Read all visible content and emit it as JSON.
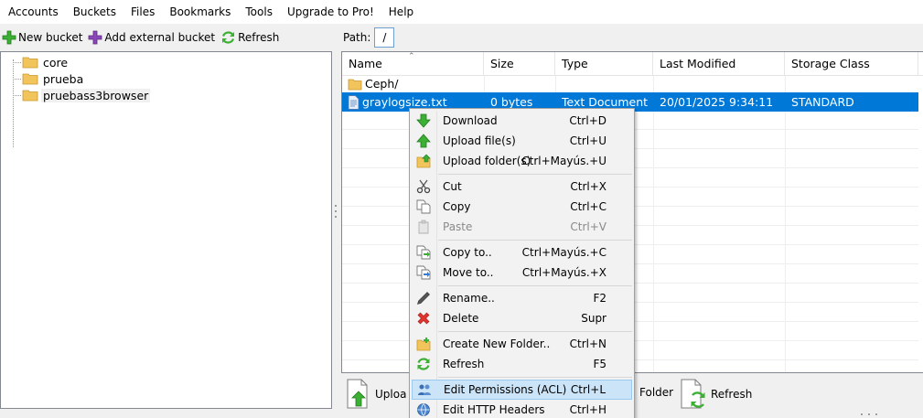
{
  "menubar": [
    "Accounts",
    "Buckets",
    "Files",
    "Bookmarks",
    "Tools",
    "Upgrade to Pro!",
    "Help"
  ],
  "left_toolbar": {
    "new_bucket": "New bucket",
    "add_external_bucket": "Add external bucket",
    "refresh": "Refresh"
  },
  "tree": {
    "items": [
      {
        "label": "core"
      },
      {
        "label": "prueba"
      },
      {
        "label": "pruebass3browser"
      }
    ]
  },
  "path": {
    "label": "Path:",
    "value": "/"
  },
  "file_list": {
    "columns": [
      "Name",
      "Size",
      "Type",
      "Last Modified",
      "Storage Class"
    ],
    "rows": [
      {
        "name": "Ceph/",
        "size": "",
        "type": "",
        "modified": "",
        "storage": ""
      },
      {
        "name": "graylogsize.txt",
        "size": "0 bytes",
        "type": "Text Document",
        "modified": "20/01/2025 9:34:11",
        "storage": "STANDARD"
      }
    ]
  },
  "bottom_toolbar": {
    "upload": "Uploa",
    "new_folder": "Folder",
    "refresh": "Refresh"
  },
  "context_menu": {
    "items": [
      {
        "label": "Download",
        "shortcut": "Ctrl+D",
        "icon": "download-arrow-icon"
      },
      {
        "label": "Upload file(s)",
        "shortcut": "Ctrl+U",
        "icon": "upload-arrow-icon"
      },
      {
        "label": "Upload folder(s)",
        "shortcut": "Ctrl+Mayús.+U",
        "icon": "upload-folder-icon"
      },
      {
        "label": "Cut",
        "shortcut": "Ctrl+X",
        "icon": "scissors-icon"
      },
      {
        "label": "Copy",
        "shortcut": "Ctrl+C",
        "icon": "copy-icon"
      },
      {
        "label": "Paste",
        "shortcut": "Ctrl+V",
        "icon": "paste-icon"
      },
      {
        "label": "Copy to..",
        "shortcut": "Ctrl+Mayús.+C",
        "icon": "copy-to-icon"
      },
      {
        "label": "Move to..",
        "shortcut": "Ctrl+Mayús.+X",
        "icon": "move-to-icon"
      },
      {
        "label": "Rename..",
        "shortcut": "F2",
        "icon": "pencil-icon"
      },
      {
        "label": "Delete",
        "shortcut": "Supr",
        "icon": "red-x-icon"
      },
      {
        "label": "Create New Folder..",
        "shortcut": "Ctrl+N",
        "icon": "new-folder-icon"
      },
      {
        "label": "Refresh",
        "shortcut": "F5",
        "icon": "refresh-icon"
      },
      {
        "label": "Edit Permissions (ACL)",
        "shortcut": "Ctrl+L",
        "icon": "permissions-icon"
      },
      {
        "label": "Edit HTTP Headers",
        "shortcut": "Ctrl+H",
        "icon": "http-headers-icon"
      }
    ]
  },
  "colors": {
    "selection": "#0078d7",
    "menu_highlight": "#cce4f7",
    "folder": "#f2c55c",
    "green": "#3cb034",
    "purple": "#8a47b8"
  }
}
